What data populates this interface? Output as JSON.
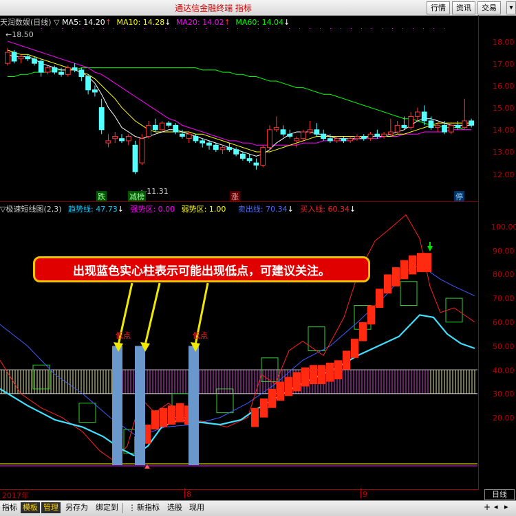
{
  "window": {
    "title": "通达信金融终端  指标",
    "top_buttons": [
      "行情",
      "资讯",
      "交易"
    ]
  },
  "main_chart": {
    "stock_name": "天润数娱(日线)",
    "ma_legend": [
      {
        "label": "MA5: 14.20",
        "color": "#ffffff"
      },
      {
        "label": "MA10: 14.28",
        "color": "#ffff00"
      },
      {
        "label": "MA20: 14.02",
        "color": "#ff00ff"
      },
      {
        "label": "MA60: 14.04",
        "color": "#00ff00"
      }
    ],
    "high_label": "18.50",
    "low_label": "11.31",
    "price_axis": [
      "18.00",
      "17.00",
      "16.00",
      "15.00",
      "14.00",
      "13.00",
      "12.00"
    ],
    "badges": [
      {
        "text": "跌",
        "color": "#00a000"
      },
      {
        "text": "减榜",
        "color": "#00a000"
      },
      {
        "text": "涨",
        "color": "#c00000"
      },
      {
        "text": "停",
        "color": "#0066cc"
      }
    ],
    "candles": [
      [
        17.0,
        17.7,
        16.9,
        17.5
      ],
      [
        17.5,
        17.6,
        17.0,
        17.1
      ],
      [
        17.2,
        17.4,
        17.0,
        17.3
      ],
      [
        17.3,
        17.4,
        17.1,
        17.2
      ],
      [
        17.2,
        17.3,
        16.9,
        17.0
      ],
      [
        17.1,
        17.2,
        16.4,
        16.6
      ],
      [
        16.6,
        16.9,
        16.5,
        16.8
      ],
      [
        16.8,
        16.9,
        16.5,
        16.6
      ],
      [
        16.6,
        16.8,
        16.4,
        16.5
      ],
      [
        16.5,
        16.9,
        16.4,
        16.8
      ],
      [
        16.8,
        17.0,
        16.6,
        16.7
      ],
      [
        16.7,
        16.8,
        16.2,
        16.4
      ],
      [
        16.4,
        16.5,
        15.6,
        15.8
      ],
      [
        15.8,
        16.0,
        15.5,
        15.7
      ],
      [
        15.0,
        15.4,
        13.8,
        14.0
      ],
      [
        13.4,
        13.8,
        13.2,
        13.5
      ],
      [
        13.6,
        13.9,
        13.4,
        13.7
      ],
      [
        13.6,
        13.8,
        13.4,
        13.5
      ],
      [
        13.5,
        13.8,
        13.3,
        13.7
      ],
      [
        13.3,
        13.5,
        12.0,
        12.1
      ],
      [
        12.5,
        13.8,
        12.4,
        13.6
      ],
      [
        13.7,
        14.4,
        13.6,
        14.2
      ],
      [
        14.2,
        14.5,
        13.9,
        14.0
      ],
      [
        14.0,
        14.4,
        13.9,
        14.3
      ],
      [
        14.3,
        14.4,
        14.1,
        14.2
      ],
      [
        14.2,
        14.3,
        13.8,
        13.9
      ],
      [
        13.8,
        14.0,
        13.6,
        13.7
      ],
      [
        13.6,
        13.9,
        13.4,
        13.8
      ],
      [
        13.7,
        13.8,
        13.4,
        13.5
      ],
      [
        13.5,
        13.6,
        13.2,
        13.4
      ],
      [
        13.4,
        13.5,
        13.1,
        13.3
      ],
      [
        13.3,
        13.4,
        13.0,
        13.1
      ],
      [
        13.1,
        13.3,
        12.9,
        13.2
      ],
      [
        13.2,
        13.4,
        13.0,
        13.1
      ],
      [
        13.1,
        13.2,
        12.8,
        12.9
      ],
      [
        12.9,
        13.0,
        12.6,
        12.7
      ],
      [
        12.7,
        12.9,
        12.5,
        12.6
      ],
      [
        12.5,
        12.7,
        12.2,
        12.4
      ],
      [
        12.4,
        13.3,
        12.3,
        13.2
      ],
      [
        13.2,
        14.2,
        13.1,
        14.0
      ],
      [
        14.0,
        14.6,
        13.9,
        14.1
      ],
      [
        14.0,
        14.2,
        13.7,
        13.8
      ],
      [
        13.8,
        14.0,
        13.6,
        13.7
      ],
      [
        13.5,
        13.7,
        13.2,
        13.6
      ],
      [
        13.6,
        14.0,
        13.5,
        13.9
      ],
      [
        13.9,
        14.4,
        13.8,
        14.0
      ],
      [
        14.0,
        14.3,
        13.7,
        13.8
      ],
      [
        13.8,
        14.0,
        13.5,
        13.6
      ],
      [
        13.6,
        13.8,
        13.4,
        13.5
      ],
      [
        13.5,
        13.7,
        13.4,
        13.6
      ],
      [
        13.6,
        13.7,
        13.4,
        13.5
      ],
      [
        13.5,
        13.7,
        13.4,
        13.6
      ],
      [
        13.6,
        13.8,
        13.5,
        13.7
      ],
      [
        13.7,
        13.8,
        13.5,
        13.6
      ],
      [
        13.6,
        13.9,
        13.5,
        13.8
      ],
      [
        13.8,
        14.0,
        13.6,
        13.7
      ],
      [
        13.7,
        13.9,
        13.6,
        13.8
      ],
      [
        13.8,
        14.5,
        13.7,
        13.9
      ],
      [
        13.9,
        14.4,
        13.8,
        14.2
      ],
      [
        14.2,
        14.6,
        14.0,
        14.1
      ],
      [
        14.1,
        14.8,
        14.0,
        14.6
      ],
      [
        14.6,
        15.0,
        14.4,
        14.8
      ],
      [
        14.8,
        15.1,
        14.2,
        14.4
      ],
      [
        14.4,
        14.6,
        14.0,
        14.1
      ],
      [
        14.1,
        14.3,
        13.9,
        14.2
      ],
      [
        14.2,
        14.4,
        13.8,
        13.9
      ],
      [
        13.9,
        14.3,
        13.8,
        14.2
      ],
      [
        14.2,
        14.4,
        14.0,
        14.1
      ],
      [
        14.1,
        15.4,
        14.0,
        14.4
      ],
      [
        14.4,
        14.5,
        14.1,
        14.2
      ]
    ],
    "ma5": [
      17.4,
      17.3,
      17.3,
      17.3,
      17.2,
      17.0,
      16.9,
      16.8,
      16.7,
      16.7,
      16.7,
      16.6,
      16.4,
      16.1,
      15.6,
      15.0,
      14.6,
      14.1,
      13.9,
      13.7,
      13.6,
      13.7,
      13.8,
      13.9,
      14.0,
      14.0,
      13.9,
      13.8,
      13.7,
      13.6,
      13.5,
      13.4,
      13.3,
      13.2,
      13.1,
      13.0,
      12.9,
      12.8,
      12.9,
      13.1,
      13.4,
      13.6,
      13.8,
      13.9,
      13.9,
      13.9,
      13.8,
      13.8,
      13.7,
      13.6,
      13.6,
      13.6,
      13.6,
      13.6,
      13.7,
      13.7,
      13.7,
      13.8,
      13.9,
      14.0,
      14.2,
      14.4,
      14.5,
      14.5,
      14.4,
      14.3,
      14.2,
      14.2,
      14.2,
      14.2
    ],
    "ma10": [
      17.6,
      17.5,
      17.4,
      17.4,
      17.3,
      17.2,
      17.1,
      17.0,
      16.9,
      16.8,
      16.7,
      16.6,
      16.5,
      16.3,
      16.0,
      15.7,
      15.4,
      15.0,
      14.7,
      14.4,
      14.2,
      14.0,
      13.9,
      13.9,
      13.9,
      13.9,
      13.9,
      13.9,
      13.8,
      13.8,
      13.7,
      13.6,
      13.5,
      13.4,
      13.3,
      13.2,
      13.1,
      13.0,
      13.0,
      13.0,
      13.1,
      13.2,
      13.3,
      13.4,
      13.5,
      13.6,
      13.7,
      13.7,
      13.7,
      13.7,
      13.7,
      13.7,
      13.7,
      13.7,
      13.7,
      13.7,
      13.7,
      13.7,
      13.8,
      13.8,
      13.9,
      14.0,
      14.1,
      14.2,
      14.3,
      14.3,
      14.3,
      14.3,
      14.3,
      14.3
    ],
    "ma20": [
      18.0,
      17.9,
      17.8,
      17.7,
      17.6,
      17.5,
      17.4,
      17.3,
      17.2,
      17.1,
      17.0,
      16.9,
      16.8,
      16.6,
      16.5,
      16.3,
      16.1,
      15.9,
      15.7,
      15.5,
      15.3,
      15.1,
      14.9,
      14.7,
      14.5,
      14.4,
      14.2,
      14.1,
      14.0,
      13.9,
      13.8,
      13.7,
      13.6,
      13.5,
      13.5,
      13.4,
      13.4,
      13.3,
      13.3,
      13.3,
      13.3,
      13.3,
      13.3,
      13.3,
      13.4,
      13.4,
      13.4,
      13.5,
      13.5,
      13.5,
      13.5,
      13.5,
      13.6,
      13.6,
      13.6,
      13.6,
      13.7,
      13.7,
      13.7,
      13.8,
      13.8,
      13.8,
      13.9,
      13.9,
      13.9,
      13.9,
      14.0,
      14.0,
      14.0,
      14.0
    ],
    "ma60": [
      16.4,
      16.4,
      16.5,
      16.5,
      16.6,
      16.6,
      16.6,
      16.7,
      16.7,
      16.7,
      16.7,
      16.8,
      16.8,
      16.8,
      16.8,
      16.8,
      16.8,
      16.8,
      16.8,
      16.8,
      16.8,
      16.8,
      16.8,
      16.8,
      16.8,
      16.8,
      16.8,
      16.8,
      16.8,
      16.7,
      16.7,
      16.7,
      16.6,
      16.6,
      16.5,
      16.5,
      16.4,
      16.4,
      16.3,
      16.2,
      16.2,
      16.1,
      16.0,
      15.9,
      15.9,
      15.8,
      15.7,
      15.6,
      15.6,
      15.5,
      15.4,
      15.3,
      15.2,
      15.1,
      15.0,
      14.9,
      14.8,
      14.7,
      14.6,
      14.5,
      14.5,
      14.4,
      14.3,
      14.2,
      14.2,
      14.1,
      14.1,
      14.1,
      14.0,
      14.0
    ]
  },
  "indicator": {
    "name": "极速短线图(2,3)",
    "legend": [
      {
        "label": "趋势线: 47.73",
        "color": "#00ccff"
      },
      {
        "label": "强势区: 0.00",
        "color": "#ff00ff"
      },
      {
        "label": "弱势区: 1.00",
        "color": "#ffff00"
      },
      {
        "label": "卖出线: 70.34",
        "color": "#4a6cff"
      },
      {
        "label": "买入线: 60.34",
        "color": "#ff2020"
      }
    ],
    "y_axis": [
      "100.00",
      "90.00",
      "80.00",
      "70.00",
      "60.00",
      "50.00",
      "40.00",
      "30.00",
      "20.00"
    ],
    "low_point_label": "低点",
    "callout": "出现蓝色实心柱表示可能出现低点，可建议关注。"
  },
  "time_axis": {
    "labels": [
      "2017年",
      "8",
      "9"
    ],
    "period_label": "日线"
  },
  "toolbar": {
    "items": [
      "指标",
      "模板",
      "管理",
      "另存为",
      "绑定到",
      "新指标",
      "选股",
      "现用"
    ]
  },
  "colors": {
    "up": "#ff3232",
    "down": "#54ffff",
    "axis": "#c00000"
  }
}
